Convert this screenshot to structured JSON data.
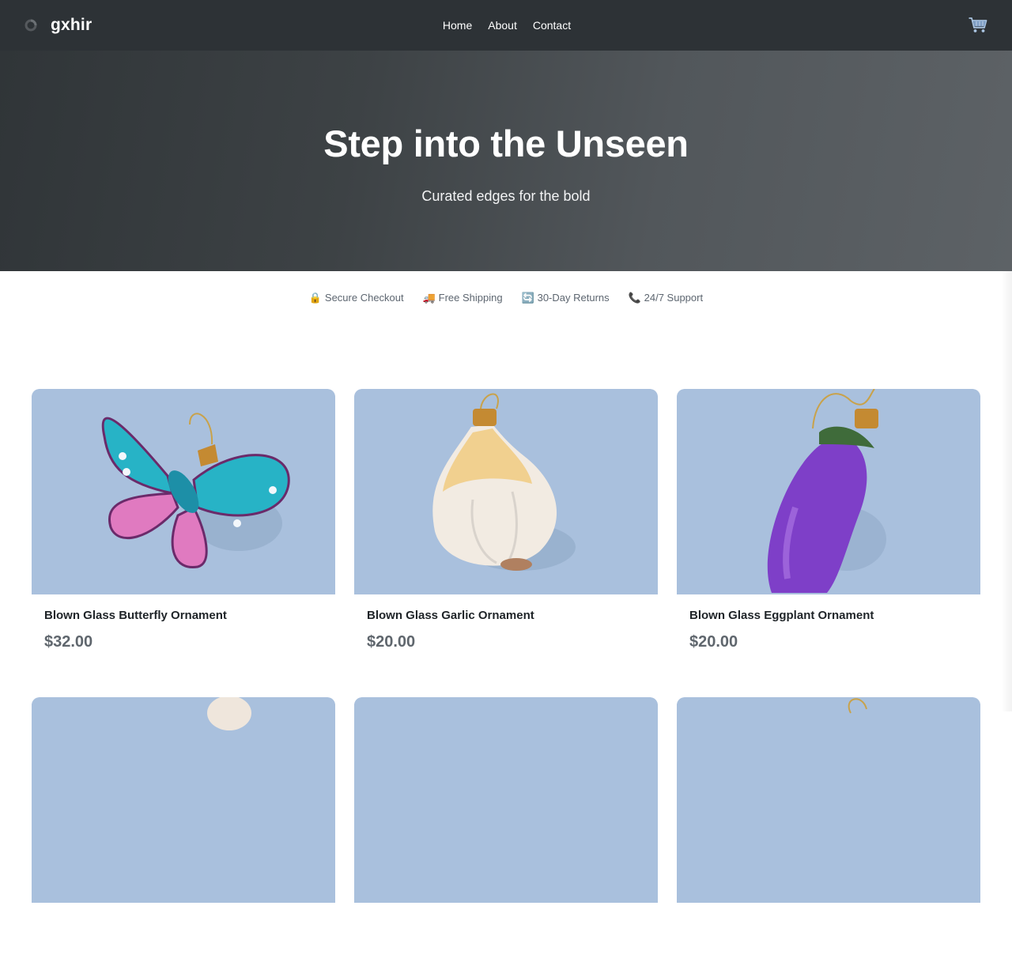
{
  "header": {
    "brand_name": "gxhir",
    "logo_icon": "ring-logo-icon",
    "nav": [
      {
        "label": "Home"
      },
      {
        "label": "About"
      },
      {
        "label": "Contact"
      }
    ],
    "cart_icon": "cart-icon"
  },
  "hero": {
    "title": "Step into the Unseen",
    "subtitle": "Curated edges for the bold"
  },
  "trust_badges": [
    {
      "icon": "lock-icon",
      "glyph": "🔒",
      "label": "Secure Checkout"
    },
    {
      "icon": "truck-icon",
      "glyph": "🚚",
      "label": "Free Shipping"
    },
    {
      "icon": "returns-icon",
      "glyph": "🔄",
      "label": "30-Day Returns"
    },
    {
      "icon": "phone-icon",
      "glyph": "📞",
      "label": "24/7 Support"
    }
  ],
  "products": [
    {
      "name": "Blown Glass Butterfly Ornament",
      "price": "$32.00"
    },
    {
      "name": "Blown Glass Garlic Ornament",
      "price": "$20.00"
    },
    {
      "name": "Blown Glass Eggplant Ornament",
      "price": "$20.00"
    },
    {
      "name": "",
      "price": ""
    },
    {
      "name": "",
      "price": ""
    },
    {
      "name": "",
      "price": ""
    }
  ],
  "colors": {
    "header_bg": "#2d3236",
    "hero_gradient_start": "#303538",
    "hero_gradient_end": "#5d6266",
    "product_image_bg": "#a9c0dd",
    "price_text": "#5f666d"
  }
}
